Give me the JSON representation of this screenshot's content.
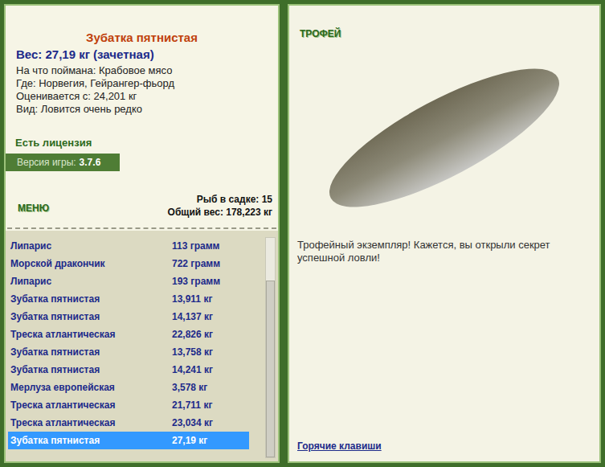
{
  "fish_card": {
    "title": "Зубатка пятнистая",
    "weight": "Вес: 27,19 кг (зачетная)",
    "details": [
      "На что поймана: Крабовое мясо",
      "Где: Норвегия, Гейрангер-фьорд",
      "Оценивается с: 24,201 кг",
      "Вид: Ловится очень редко"
    ],
    "license": "Есть лицензия",
    "version_label": "Версия игры:",
    "version": "3.7.6"
  },
  "menu": "МЕНЮ",
  "keepnet_summary": [
    "Рыб в садке: 15",
    "Общий вес: 178,223 кг"
  ],
  "catch_list": [
    {
      "name": "Липарис",
      "weight": "113 грамм",
      "selected": false
    },
    {
      "name": "Морской дракончик",
      "weight": "722 грамм",
      "selected": false
    },
    {
      "name": "Липарис",
      "weight": "193 грамм",
      "selected": false
    },
    {
      "name": "Зубатка пятнистая",
      "weight": "13,911 кг",
      "selected": false
    },
    {
      "name": "Зубатка пятнистая",
      "weight": "14,137 кг",
      "selected": false
    },
    {
      "name": "Треска атлантическая",
      "weight": "22,826 кг",
      "selected": false
    },
    {
      "name": "Зубатка пятнистая",
      "weight": "13,758 кг",
      "selected": false
    },
    {
      "name": "Зубатка пятнистая",
      "weight": "14,241 кг",
      "selected": false
    },
    {
      "name": "Мерлуза европейская",
      "weight": "3,578 кг",
      "selected": false
    },
    {
      "name": "Треска атлантическая",
      "weight": "21,711 кг",
      "selected": false
    },
    {
      "name": "Треска атлантическая",
      "weight": "23,034 кг",
      "selected": false
    },
    {
      "name": "Зубатка пятнистая",
      "weight": "27,19 кг",
      "selected": true
    }
  ],
  "trophy": {
    "label": "ТРОФЕЙ",
    "message": "Трофейный экземпляр! Кажется, вы открыли секрет успешной ловли!"
  },
  "hotkeys_link": "Горячие клавиши"
}
